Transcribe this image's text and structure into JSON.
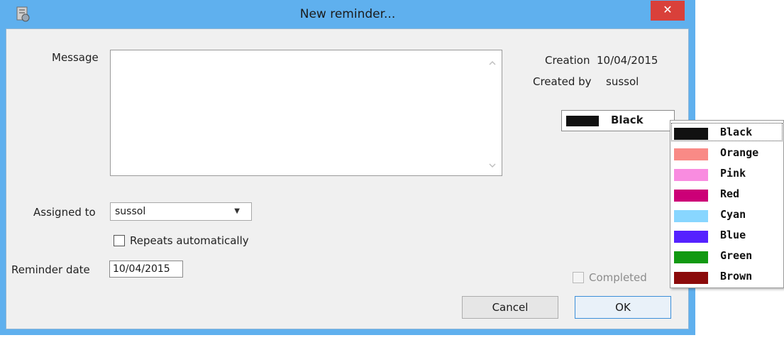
{
  "window": {
    "title": "New reminder...",
    "close_glyph": "✕"
  },
  "form": {
    "message_label": "Message",
    "message_value": "",
    "assigned_label": "Assigned to",
    "assigned_value": "sussol",
    "repeats_label": "Repeats automatically",
    "repeats_checked": false,
    "reminder_date_label": "Reminder date",
    "reminder_date_value": "10/04/2015",
    "completed_label": "Completed",
    "completed_checked": false
  },
  "info": {
    "creation_label": "Creation",
    "creation_value": "10/04/2015",
    "created_by_label": "Created by",
    "created_by_value": "sussol"
  },
  "color_picker": {
    "selected": {
      "name": "Black",
      "color": "#111111"
    },
    "options": [
      {
        "name": "Black",
        "color": "#111111"
      },
      {
        "name": "Orange",
        "color": "#f98a86"
      },
      {
        "name": "Pink",
        "color": "#f98ce0"
      },
      {
        "name": "Red",
        "color": "#cc0077"
      },
      {
        "name": "Cyan",
        "color": "#88d6ff"
      },
      {
        "name": "Blue",
        "color": "#5522ff"
      },
      {
        "name": "Green",
        "color": "#119911"
      },
      {
        "name": "Brown",
        "color": "#8b0a0a"
      }
    ]
  },
  "buttons": {
    "cancel": "Cancel",
    "ok": "OK"
  },
  "icons": {
    "app": "app-icon",
    "close": "close-icon",
    "dropdown": "chevron-down-icon",
    "scroll_up": "scroll-up-arrow-icon",
    "scroll_down": "scroll-down-arrow-icon"
  }
}
